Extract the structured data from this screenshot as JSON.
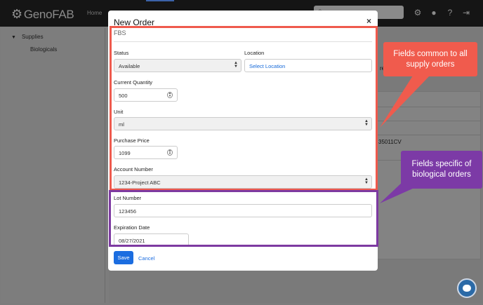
{
  "navbar": {
    "brand": "GenoFAB",
    "home_label": "Home",
    "icons": [
      "search-icon",
      "gear-icon",
      "user-icon",
      "help-icon",
      "logout-icon"
    ]
  },
  "sidebar": {
    "items": [
      {
        "label": "Supplies",
        "expanded": true
      },
      {
        "label": "Biologicals"
      }
    ]
  },
  "background": {
    "text_fragment_1": "re",
    "text_fragment_2": "35011CV"
  },
  "modal": {
    "title": "New Order",
    "close_glyph": "×",
    "supply_name": "FBS",
    "fields": {
      "status": {
        "label": "Status",
        "value": "Available"
      },
      "location": {
        "label": "Location",
        "value": "Select Location"
      },
      "current_quantity": {
        "label": "Current Quantity",
        "value": "500"
      },
      "unit": {
        "label": "Unit",
        "value": "ml"
      },
      "purchase_price": {
        "label": "Purchase Price",
        "value": "1099"
      },
      "account_number": {
        "label": "Account Number",
        "value": "1234-Project ABC"
      },
      "lot_number": {
        "label": "Lot Number",
        "value": "123456"
      },
      "expiration_date": {
        "label": "Expiration Date",
        "value": "08/27/2021"
      }
    },
    "buttons": {
      "save": "Save",
      "cancel": "Cancel"
    }
  },
  "annotations": {
    "common": {
      "text": "Fields common to all supply orders",
      "color": "#f05b4d"
    },
    "specific": {
      "text": "Fields specific of biological orders",
      "color": "#7c3aa6"
    }
  }
}
